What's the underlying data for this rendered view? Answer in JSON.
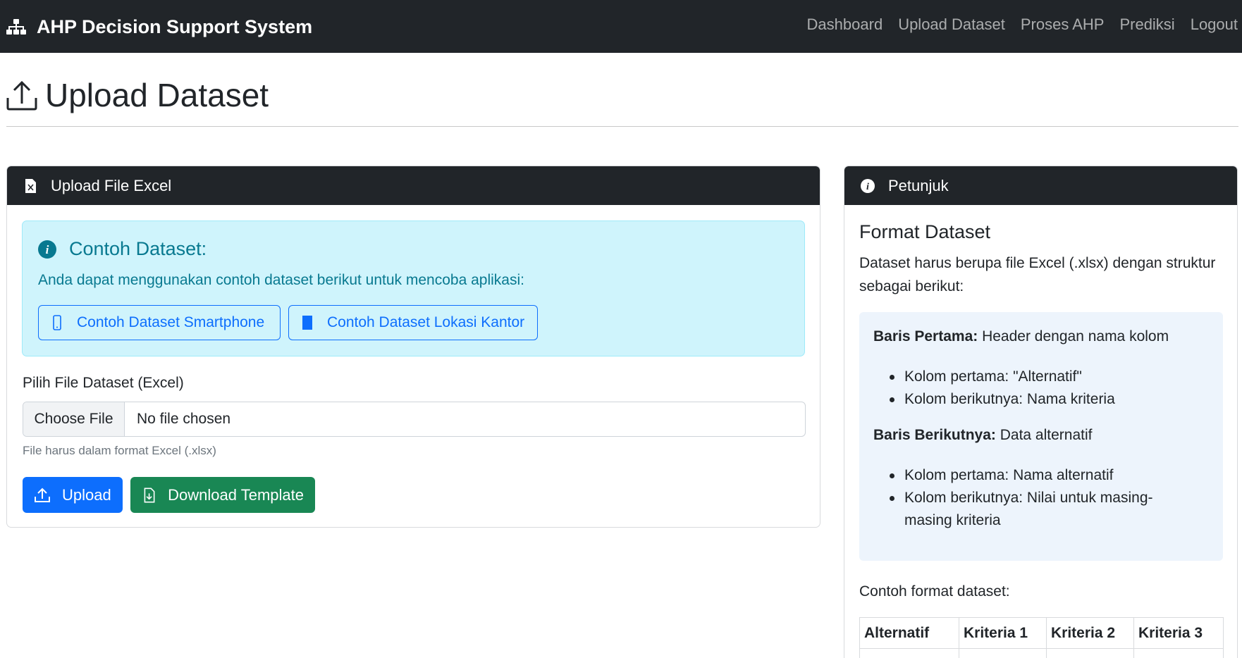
{
  "navbar": {
    "brand": "AHP Decision Support System",
    "brand_icon": "sitemap-icon",
    "links": [
      "Dashboard",
      "Upload Dataset",
      "Proses AHP",
      "Prediksi",
      "Logout"
    ]
  },
  "page": {
    "title": "Upload Dataset",
    "title_icon": "upload-icon"
  },
  "upload_card": {
    "header": "Upload File Excel",
    "header_icon": "file-excel-icon",
    "alert": {
      "title": "Contoh Dataset:",
      "text": "Anda dapat menggunakan contoh dataset berikut untuk mencoba aplikasi:",
      "buttons": [
        "Contoh Dataset Smartphone",
        "Contoh Dataset Lokasi Kantor"
      ]
    },
    "file_label": "Pilih File Dataset (Excel)",
    "file_button": "Choose File",
    "file_status": "No file chosen",
    "help_text": "File harus dalam format Excel (.xlsx)",
    "upload_button": "Upload",
    "download_button": "Download Template"
  },
  "petunjuk_card": {
    "header": "Petunjuk",
    "header_icon": "info-circle-icon",
    "format_title": "Format Dataset",
    "format_desc": "Dataset harus berupa file Excel (.xlsx) dengan struktur sebagai berikut:",
    "baris_pertama_label": "Baris Pertama:",
    "baris_pertama_text": " Header dengan nama kolom",
    "baris_pertama_items": [
      "Kolom pertama: \"Alternatif\"",
      "Kolom berikutnya: Nama kriteria"
    ],
    "baris_berikutnya_label": "Baris Berikutnya:",
    "baris_berikutnya_text": " Data alternatif",
    "baris_berikutnya_items": [
      "Kolom pertama: Nama alternatif",
      "Kolom berikutnya: Nilai untuk masing-masing kriteria"
    ],
    "contoh_label": "Contoh format dataset:",
    "table_headers": [
      "Alternatif",
      "Kriteria 1",
      "Kriteria 2",
      "Kriteria 3"
    ]
  },
  "colors": {
    "navbar": "#212529",
    "primary": "#0d6efd",
    "success": "#198754",
    "info_bg": "#cff4fc",
    "info_text": "#087990"
  }
}
